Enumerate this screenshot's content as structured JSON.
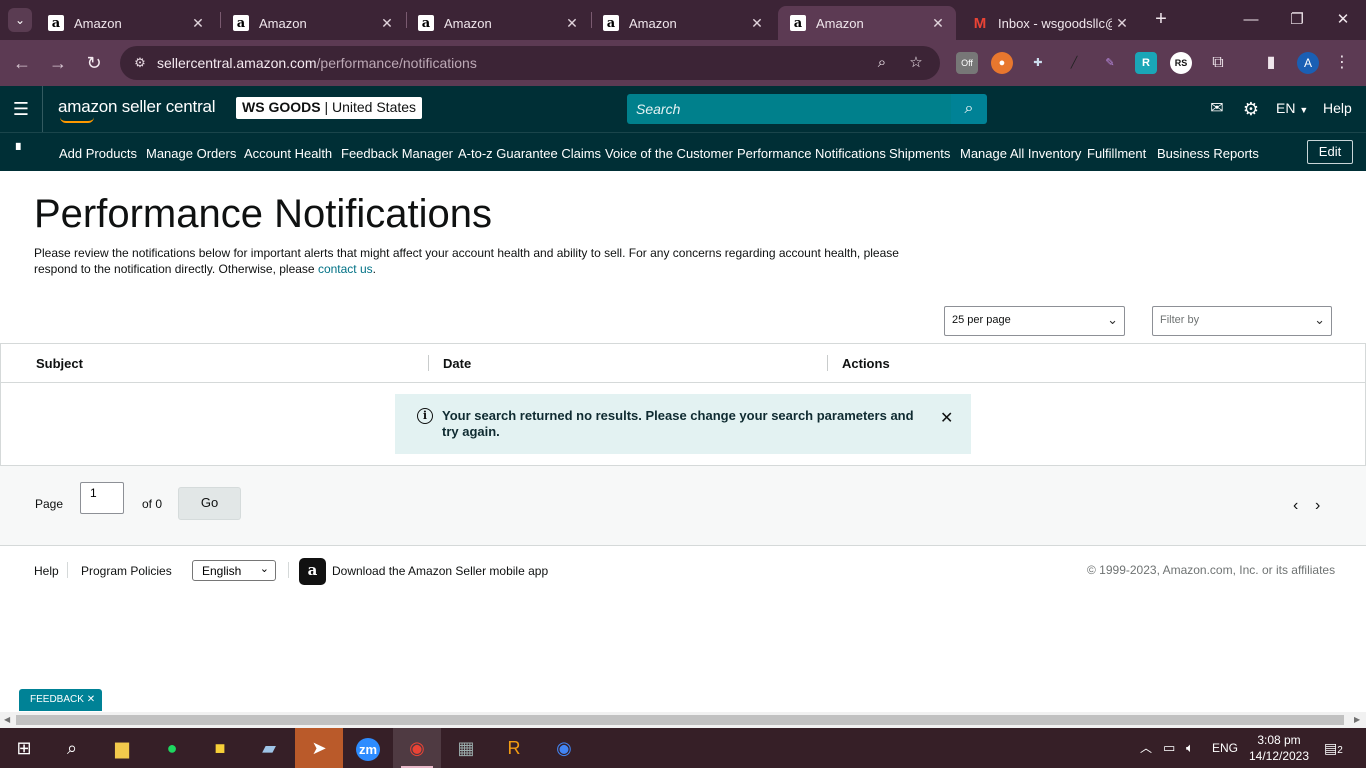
{
  "browser": {
    "tabs": [
      {
        "title": "Amazon",
        "favicon": "a",
        "active": false
      },
      {
        "title": "Amazon",
        "favicon": "a",
        "active": false
      },
      {
        "title": "Amazon",
        "favicon": "a",
        "active": false
      },
      {
        "title": "Amazon",
        "favicon": "a",
        "active": false
      },
      {
        "title": "Amazon",
        "favicon": "a",
        "active": true
      },
      {
        "title": "Inbox - wsgoodsllc@",
        "favicon": "M",
        "active": false
      }
    ],
    "url_host": "sellercentral.amazon.com",
    "url_path": "/performance/notifications",
    "profile_initial": "A",
    "ext_off_label": "Off",
    "ext_rs_label": "RS"
  },
  "header": {
    "logo_text": "amazon seller central",
    "store_name": "WS GOODS",
    "store_region": "United States",
    "search_placeholder": "Search",
    "language": "EN",
    "help": "Help"
  },
  "nav": {
    "items": [
      "Add Products",
      "Manage Orders",
      "Account Health",
      "Feedback Manager",
      "A-to-z Guarantee Claims",
      "Voice of the Customer",
      "Performance Notifications",
      "Shipments",
      "Manage All Inventory",
      "Fulfillment",
      "Business Reports"
    ],
    "edit": "Edit"
  },
  "page": {
    "title": "Performance Notifications",
    "description": "Please review the notifications below for important alerts that might affect your account health and ability to sell. For any concerns regarding account health, please respond to the notification directly. Otherwise, please",
    "contact_link": "contact us",
    "per_page": "25 per page",
    "filter_placeholder": "Filter by"
  },
  "table": {
    "columns": [
      "Subject",
      "Date",
      "Actions"
    ],
    "empty_message": "Your search returned no results. Please change your search parameters and try again."
  },
  "pager": {
    "page_label": "Page",
    "page_value": "1",
    "of_label": "of 0",
    "go": "Go"
  },
  "footer": {
    "help": "Help",
    "program_policies": "Program Policies",
    "language": "English",
    "app_text": "Download the Amazon Seller mobile app",
    "copyright": "© 1999-2023, Amazon.com, Inc. or its affiliates"
  },
  "feedback_tab": "FEEDBACK",
  "taskbar": {
    "language": "ENG",
    "time": "3:08 pm",
    "date": "14/12/2023",
    "notifications": "2",
    "zoom_label": "zm"
  },
  "colors": {
    "header_bg": "#002f36",
    "accent_teal": "#008296",
    "link": "#007185",
    "alert_bg": "#e3f2f2",
    "browser_frame": "#5c3a53"
  }
}
